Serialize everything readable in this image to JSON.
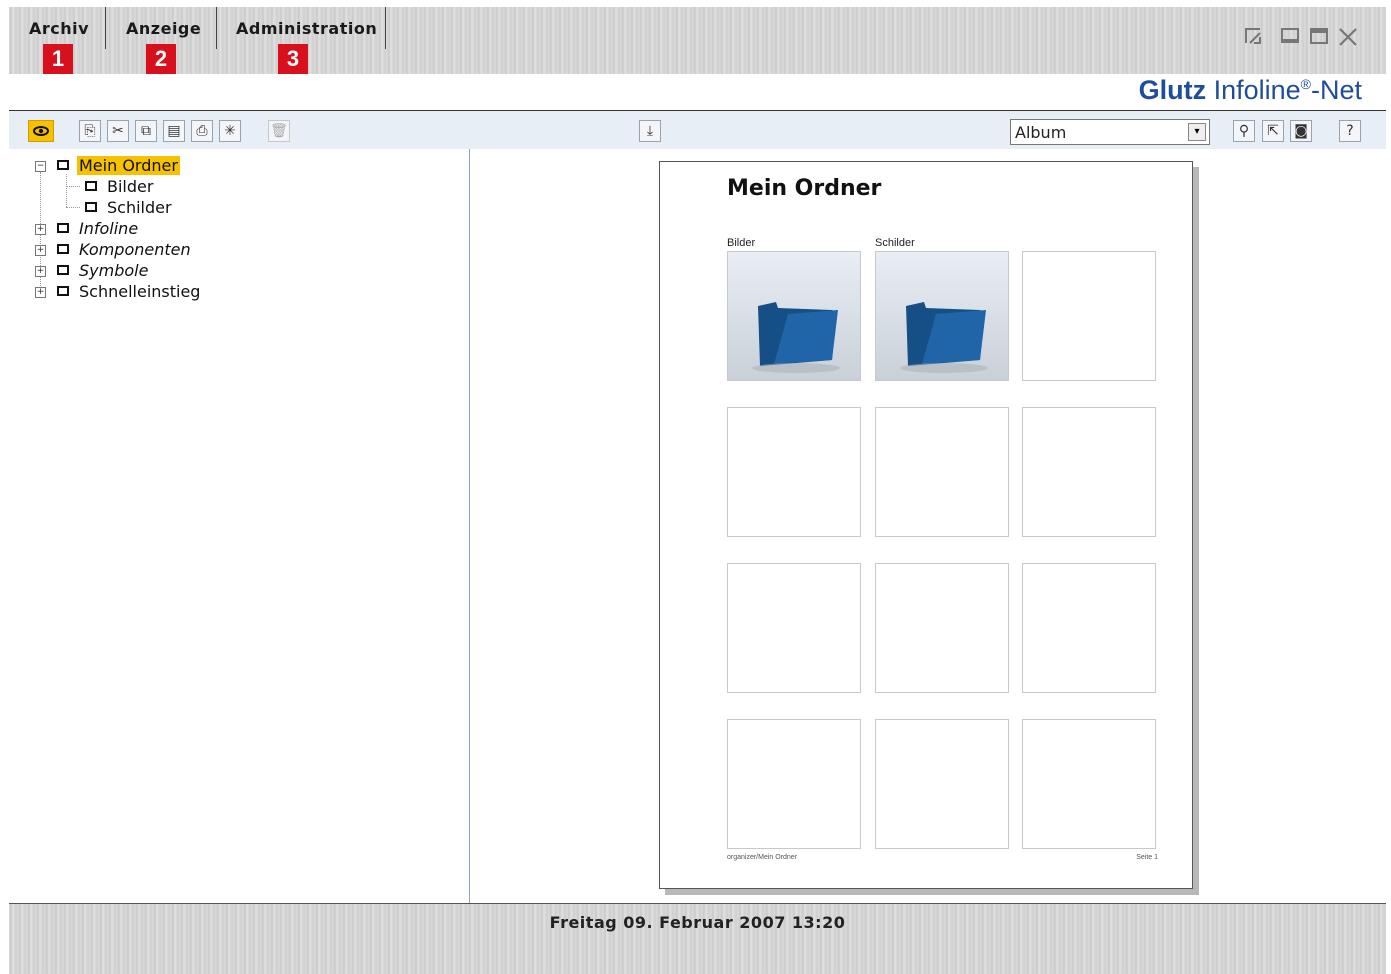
{
  "menu": {
    "tabs": [
      {
        "label": "Archiv",
        "number": "1"
      },
      {
        "label": "Anzeige",
        "number": "2"
      },
      {
        "label": "Administration",
        "number": "3"
      }
    ]
  },
  "window_controls": [
    "restore-icon",
    "minimize-icon",
    "maximize-icon",
    "close-icon"
  ],
  "brand": {
    "bold": "Glutz",
    "name": " Infoline",
    "reg": "®",
    "suffix": "-Net",
    "color": "#1f4d9c"
  },
  "toolbar": {
    "view_select": {
      "value": "Album"
    },
    "icons": [
      "eye-icon",
      "copy-icon",
      "cut-icon",
      "duplicate-icon",
      "paste-icon",
      "print-icon",
      "new-icon",
      "delete-icon",
      "download-icon",
      "search-icon",
      "select-icon",
      "preview-icon",
      "help-icon"
    ]
  },
  "tree": {
    "items": [
      {
        "label": "Mein Ordner",
        "selected": true
      },
      {
        "label": "Bilder"
      },
      {
        "label": "Schilder"
      },
      {
        "label": "Infoline"
      },
      {
        "label": "Komponenten"
      },
      {
        "label": "Symbole"
      },
      {
        "label": "Schnelleinstieg"
      }
    ]
  },
  "album": {
    "title": "Mein Ordner",
    "cells": [
      {
        "label": "Bilder"
      },
      {
        "label": "Schilder"
      }
    ],
    "footer_left": "organizer/Mein Ordner",
    "footer_right": "Seite 1"
  },
  "status": {
    "text": "Freitag 09. Februar 2007   13:20"
  },
  "colors": {
    "accent": "#f6c200",
    "number_badge": "#d8101e",
    "toolbar_bg": "#e8eef5"
  }
}
